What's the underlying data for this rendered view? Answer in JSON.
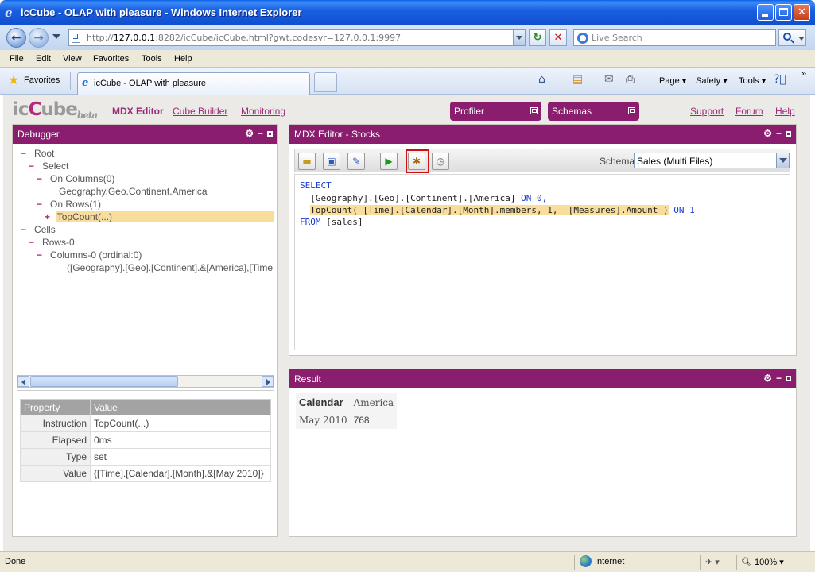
{
  "window": {
    "title": "icCube - OLAP with pleasure - Windows Internet Explorer"
  },
  "address": {
    "url_prefix": "http://",
    "url_host": "127.0.0.1",
    "url_rest": ":8282/icCube/icCube.html?gwt.codesvr=127.0.0.1:9997",
    "search_placeholder": "Live Search"
  },
  "menu": [
    "File",
    "Edit",
    "View",
    "Favorites",
    "Tools",
    "Help"
  ],
  "favorites": {
    "label": "Favorites",
    "tab_title": "icCube - OLAP with pleasure",
    "commands": {
      "page": "Page",
      "safety": "Safety",
      "tools": "Tools"
    }
  },
  "app": {
    "logo_main": "icCube",
    "logo_beta": "beta",
    "nav": {
      "mdx_editor": "MDX Editor",
      "cube_builder": "Cube Builder",
      "monitoring": "Monitoring"
    },
    "pills": {
      "profiler": "Profiler",
      "schemas": "Schemas"
    },
    "links": {
      "support": "Support",
      "forum": "Forum",
      "help": "Help"
    }
  },
  "debugger": {
    "title": "Debugger",
    "tree": [
      {
        "marker": "−",
        "label": "Root"
      },
      {
        "marker": "−",
        "label": "Select"
      },
      {
        "marker": "−",
        "label": "On Columns(0)"
      },
      {
        "marker": "",
        "label": "Geography.Geo.Continent.America"
      },
      {
        "marker": "−",
        "label": "On Rows(1)"
      },
      {
        "marker": "+",
        "label": "TopCount(...)"
      },
      {
        "marker": "−",
        "label": "Cells"
      },
      {
        "marker": "−",
        "label": "Rows-0"
      },
      {
        "marker": "−",
        "label": "Columns-0 (ordinal:0)"
      },
      {
        "marker": "",
        "label": "([Geography].[Geo].[Continent].&[America],[Time"
      }
    ],
    "props": {
      "col_property": "Property",
      "col_value": "Value",
      "rows": [
        {
          "k": "Instruction",
          "v": "TopCount(...)"
        },
        {
          "k": "Elapsed",
          "v": "0ms"
        },
        {
          "k": "Type",
          "v": "set"
        },
        {
          "k": "Value",
          "v": "{[Time].[Calendar].[Month].&[May 2010]}"
        }
      ]
    }
  },
  "editor": {
    "title": "MDX Editor - Stocks",
    "schema_label": "Schema",
    "schema_value": "Sales (Multi Files)",
    "code": {
      "l1_kw": "SELECT",
      "l2_txt": "  [Geography].[Geo].[Continent].[America]",
      "l2_kw": " ON 0,",
      "l3_hl": "TopCount( [Time].[Calendar].[Month].members, 1,  [Measures].Amount )",
      "l3_kw": " ON 1",
      "l4_kw": "FROM",
      "l4_txt": " [sales]"
    }
  },
  "result": {
    "title": "Result",
    "col_header": "Calendar",
    "col_member": "America",
    "row_member": "May 2010",
    "value": "768"
  },
  "status": {
    "left": "Done",
    "zone": "Internet",
    "zoom": "100%"
  },
  "colors": {
    "accent": "#8a1d6e",
    "highlight": "#f8dd9c"
  }
}
